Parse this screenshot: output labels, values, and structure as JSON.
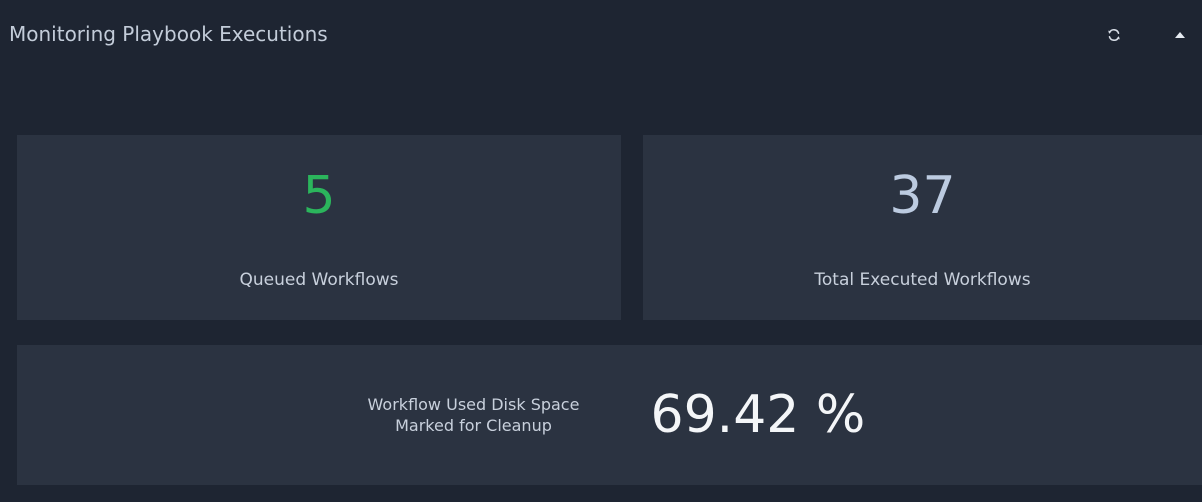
{
  "header": {
    "title": "Monitoring Playbook Executions",
    "refresh_icon": "refresh-icon",
    "collapse_icon": "caret-up-icon"
  },
  "metrics": {
    "queued": {
      "value": "5",
      "label": "Queued Workflows",
      "color": "#2bb55c"
    },
    "total": {
      "value": "37",
      "label": "Total Executed Workflows",
      "color": "#bccbe0"
    },
    "disk": {
      "label_line1": "Workflow Used Disk Space",
      "label_line2": "Marked for Cleanup",
      "value": "69.42 %",
      "color": "#f4f6f8"
    }
  },
  "colors": {
    "panel_background": "#1e2532",
    "card_background": "#2b3341",
    "title_text": "#c3ccd9",
    "label_text": "#c8d0dc"
  }
}
